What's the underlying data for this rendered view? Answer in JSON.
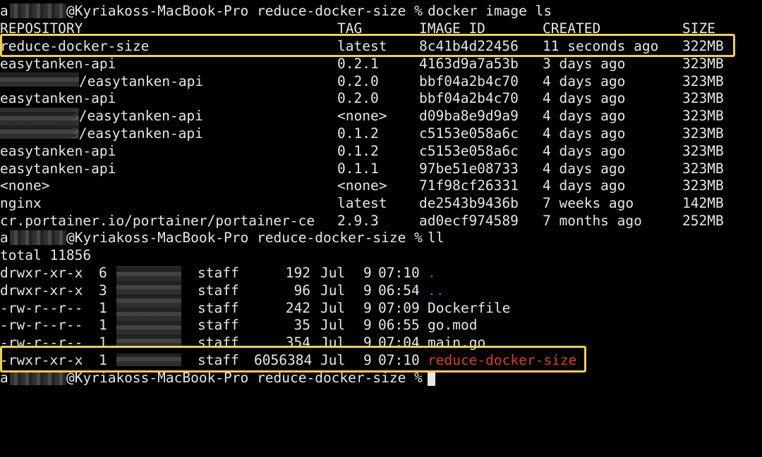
{
  "colors": {
    "background": "#000000",
    "foreground": "#e6e6e6",
    "highlight_border": "#f4d03f",
    "directory_entry": "#1f6fd6",
    "executable_entry": "#e03a2e"
  },
  "prompt": {
    "user_prefix": "a",
    "host_path": "@Kyriakoss-MacBook-Pro reduce-docker-size %"
  },
  "commands": {
    "first": "docker image ls",
    "second": "ll"
  },
  "images_table": {
    "headers": [
      "REPOSITORY",
      "TAG",
      "IMAGE ID",
      "CREATED",
      "SIZE"
    ],
    "rows": [
      {
        "repository": "reduce-docker-size",
        "tag": "latest",
        "image_id": "8c41b4d22456",
        "created": "11 seconds ago",
        "size": "322MB"
      },
      {
        "repository": "easytanken-api",
        "tag": "0.2.1",
        "image_id": "4163d9a7a53b",
        "created": "3 days ago",
        "size": "323MB"
      },
      {
        "repository": "/easytanken-api",
        "tag": "0.2.0",
        "image_id": "bbf04a2b4c70",
        "created": "4 days ago",
        "size": "323MB"
      },
      {
        "repository": "easytanken-api",
        "tag": "0.2.0",
        "image_id": "bbf04a2b4c70",
        "created": "4 days ago",
        "size": "323MB"
      },
      {
        "repository": "3/easytanken-api",
        "tag": "<none>",
        "image_id": "d09ba8e9d9a9",
        "created": "4 days ago",
        "size": "323MB"
      },
      {
        "repository": "3/easytanken-api",
        "tag": "0.1.2",
        "image_id": "c5153e058a6c",
        "created": "4 days ago",
        "size": "323MB"
      },
      {
        "repository": "easytanken-api",
        "tag": "0.1.2",
        "image_id": "c5153e058a6c",
        "created": "4 days ago",
        "size": "323MB"
      },
      {
        "repository": "easytanken-api",
        "tag": "0.1.1",
        "image_id": "97be51e08733",
        "created": "4 days ago",
        "size": "323MB"
      },
      {
        "repository": "<none>",
        "tag": "<none>",
        "image_id": "71f98cf26331",
        "created": "4 days ago",
        "size": "323MB"
      },
      {
        "repository": "nginx",
        "tag": "latest",
        "image_id": "de2543b9436b",
        "created": "7 weeks ago",
        "size": "142MB"
      },
      {
        "repository": "cr.portainer.io/portainer/portainer-ce",
        "tag": "2.9.3",
        "image_id": "ad0ecf974589",
        "created": "7 months ago",
        "size": "252MB"
      }
    ]
  },
  "listing": {
    "total": "total 11856",
    "rows": [
      {
        "perms": "drwxr-xr-x",
        "links": "6",
        "group": "staff",
        "size": "192",
        "month": "Jul",
        "day": "9",
        "time": "07:10",
        "name": ".",
        "kind": "dir"
      },
      {
        "perms": "drwxr-xr-x",
        "links": "3",
        "group": "staff",
        "size": "96",
        "month": "Jul",
        "day": "9",
        "time": "06:54",
        "name": "..",
        "kind": "dir"
      },
      {
        "perms": "-rw-r--r--",
        "links": "1",
        "group": "staff",
        "size": "242",
        "month": "Jul",
        "day": "9",
        "time": "07:09",
        "name": "Dockerfile",
        "kind": "file"
      },
      {
        "perms": "-rw-r--r--",
        "links": "1",
        "group": "staff",
        "size": "35",
        "month": "Jul",
        "day": "9",
        "time": "06:55",
        "name": "go.mod",
        "kind": "file"
      },
      {
        "perms": "-rw-r--r--",
        "links": "1",
        "group": "staff",
        "size": "354",
        "month": "Jul",
        "day": "9",
        "time": "07:04",
        "name": "main.go",
        "kind": "file"
      },
      {
        "perms": "-rwxr-xr-x",
        "links": "1",
        "group": "staff",
        "size": "6056384",
        "month": "Jul",
        "day": "9",
        "time": "07:10",
        "name": "reduce-docker-size",
        "kind": "exec"
      }
    ]
  }
}
